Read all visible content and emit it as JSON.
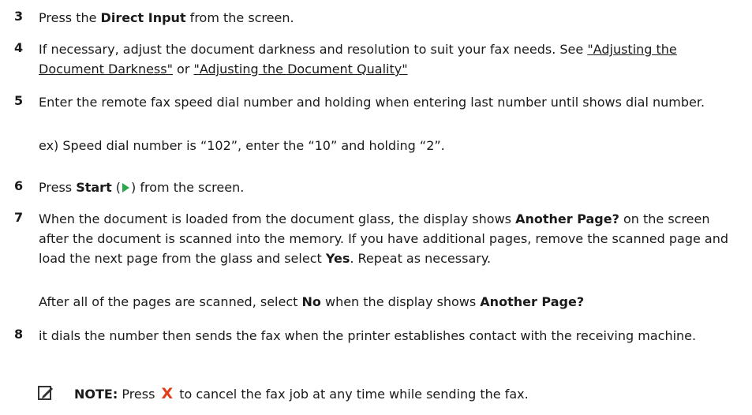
{
  "steps": [
    {
      "number": "3",
      "segments": [
        {
          "t": "Press the "
        },
        {
          "t": "Direct Input",
          "b": true
        },
        {
          "t": " from the screen."
        }
      ]
    },
    {
      "number": "4",
      "segments": [
        {
          "t": "If necessary, adjust the document darkness and resolution to suit your fax needs. See "
        },
        {
          "t": "\"Adjusting the Document Darkness\"",
          "link": true
        },
        {
          "t": " or "
        },
        {
          "t": "\"Adjusting the Document Quality\"",
          "link": true
        }
      ]
    },
    {
      "number": "5",
      "segments": [
        {
          "t": "Enter the remote fax speed dial number and holding when entering last number until shows dial number."
        }
      ]
    },
    {
      "number": "6",
      "segments": [
        {
          "t": "Press "
        },
        {
          "t": "Start",
          "b": true
        },
        {
          "t": " ("
        },
        {
          "icon": "start"
        },
        {
          "t": ") from the screen."
        }
      ]
    },
    {
      "number": "7",
      "segments": [
        {
          "t": "When the document is loaded from the document glass, the display shows "
        },
        {
          "t": "Another Page?",
          "b": true
        },
        {
          "t": " on the screen after the document is scanned into the memory. If you have additional pages, remove the scanned page and load the next page from the glass and select "
        },
        {
          "t": "Yes",
          "b": true
        },
        {
          "t": ". Repeat as necessary."
        }
      ]
    },
    {
      "number": "8",
      "segments": [
        {
          "t": "it dials the number then sends the fax when the printer establishes contact with the receiving machine."
        }
      ]
    }
  ],
  "step5_example": "ex) Speed dial number is “102”, enter the “10” and holding “2”.",
  "step7_followup": [
    {
      "t": "After all of the pages are scanned, select "
    },
    {
      "t": "No",
      "b": true
    },
    {
      "t": " when the display shows "
    },
    {
      "t": "Another Page?",
      "b": true
    }
  ],
  "note": [
    {
      "t": "NOTE:",
      "b": true
    },
    {
      "t": " Press "
    },
    {
      "icon": "cancel",
      "glyph": "X"
    },
    {
      "t": " to cancel the fax job at any time while sending the fax."
    }
  ],
  "icons": {
    "start": "start-play-icon",
    "cancel": "cancel-x-icon",
    "note": "note-pencil-icon"
  },
  "colors": {
    "start_icon": "#2aa84a",
    "cancel_icon": "#e23d1a",
    "text": "#1a1a1a"
  }
}
